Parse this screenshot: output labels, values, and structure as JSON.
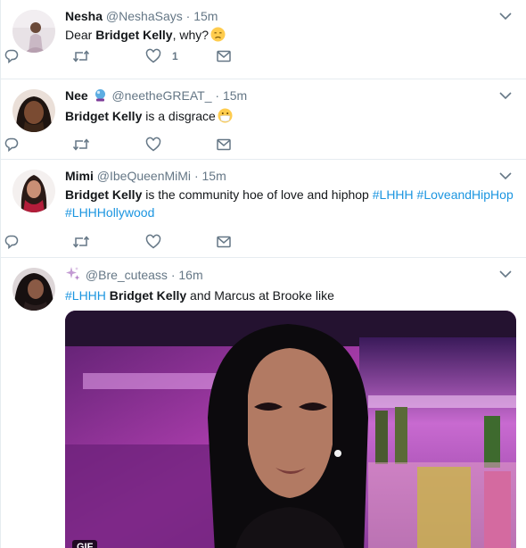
{
  "tweets": [
    {
      "name": "Nesha",
      "handle": "@NeshaSays",
      "dot": "·",
      "time": "15m",
      "text_pre": "Dear ",
      "text_bold": "Bridget Kelly",
      "text_post": ", why?",
      "emoji": "disappointed-face",
      "like_count": "1"
    },
    {
      "name": "Nee",
      "handle": "@neetheGREAT_",
      "dot": "·",
      "time": "15m",
      "text_bold": "Bridget Kelly",
      "text_post": " is a disgrace",
      "emoji": "face-with-medical-mask"
    },
    {
      "name": "Mimi",
      "handle": "@IbeQueenMiMi",
      "dot": "·",
      "time": "15m",
      "text_bold": "Bridget Kelly",
      "text_post": " is the community hoe of love and hiphop ",
      "hashtags": [
        "#LHHH",
        "#LoveandHipHop",
        "#LHHHollywood"
      ]
    },
    {
      "handle": "@Bre_cuteass",
      "dot": "·",
      "time": "16m",
      "hashtag": "#LHHH",
      "text_bold": "Bridget Kelly",
      "text_post": " and Marcus at Brooke like",
      "media_badge": "GIF"
    }
  ],
  "icons": {
    "reply": "reply-icon",
    "retweet": "retweet-icon",
    "like": "heart-icon",
    "dm": "envelope-icon",
    "more": "chevron-down-icon",
    "sparkle": "sparkles-icon"
  },
  "colors": {
    "link": "#1b95e0",
    "muted": "#657786",
    "text": "#14171a",
    "divider": "#e6ecf0"
  }
}
